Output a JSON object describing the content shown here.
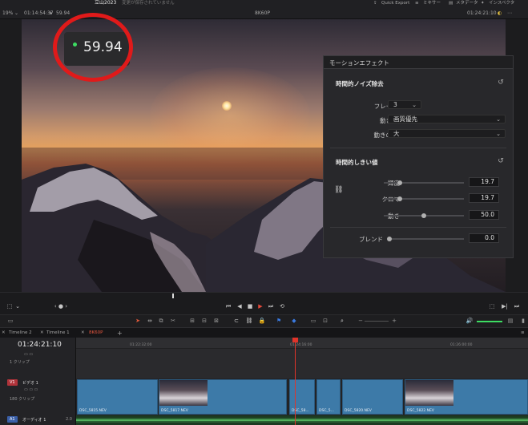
{
  "topbar": {
    "zoom": "19%",
    "tc_left": "01:14:54:37",
    "fps_small": "59.94",
    "project": "立山2023",
    "unsaved": "変更が保存されていません",
    "quick_export": "Quick Export",
    "mixer": "ミキサー",
    "metadata": "メタデータ",
    "inspector": "インスペクタ",
    "clip_label": "8K60P",
    "tc_right": "01:24:21:10"
  },
  "overlay": {
    "fps_value": "59.94"
  },
  "panel": {
    "title": "モーションエフェクト",
    "section1": "時間的ノイズ除去",
    "frames_label": "フレーム数",
    "frames_value": "3",
    "motion_est_label": "動き推定",
    "motion_est_value": "画質優先",
    "motion_range_label": "動きの範囲",
    "motion_range_value": "大",
    "section2": "時間的しきい値",
    "luma_label": "輝度",
    "luma_value": "19.7",
    "chroma_label": "クロマ",
    "chroma_value": "19.7",
    "motion_label": "動き",
    "motion_value": "50.0",
    "blend_label": "ブレンド",
    "blend_value": "0.0",
    "sliders": {
      "luma": 0.2,
      "chroma": 0.2,
      "motion": 0.5,
      "blend": 0.0
    }
  },
  "tabs": [
    "Timeline 2",
    "Timeline 1",
    "8K60P"
  ],
  "timeline": {
    "timecode": "01:24:21:10",
    "clips_top": "1 クリップ",
    "v1_badge": "V1",
    "v1_name": "ビデオ 1",
    "v1_count": "180 クリップ",
    "a1_badge": "A1",
    "a1_name": "オーディオ 1",
    "a1_level": "2.0",
    "ruler": [
      "01:22:32:00",
      "01:24:16:00",
      "01:26:00:00"
    ],
    "clips": [
      "DSC_5815.NEV",
      "DSC_5817.NEV",
      "DSC_58...",
      "DSC_5...",
      "DSC_5820.NEV",
      "DSC_5822.NEV"
    ]
  },
  "colors": {
    "playhead": "#e0342a",
    "clip": "#3d7aa8",
    "fps_dot": "#3ddc62",
    "ring": "#e01a1a"
  }
}
